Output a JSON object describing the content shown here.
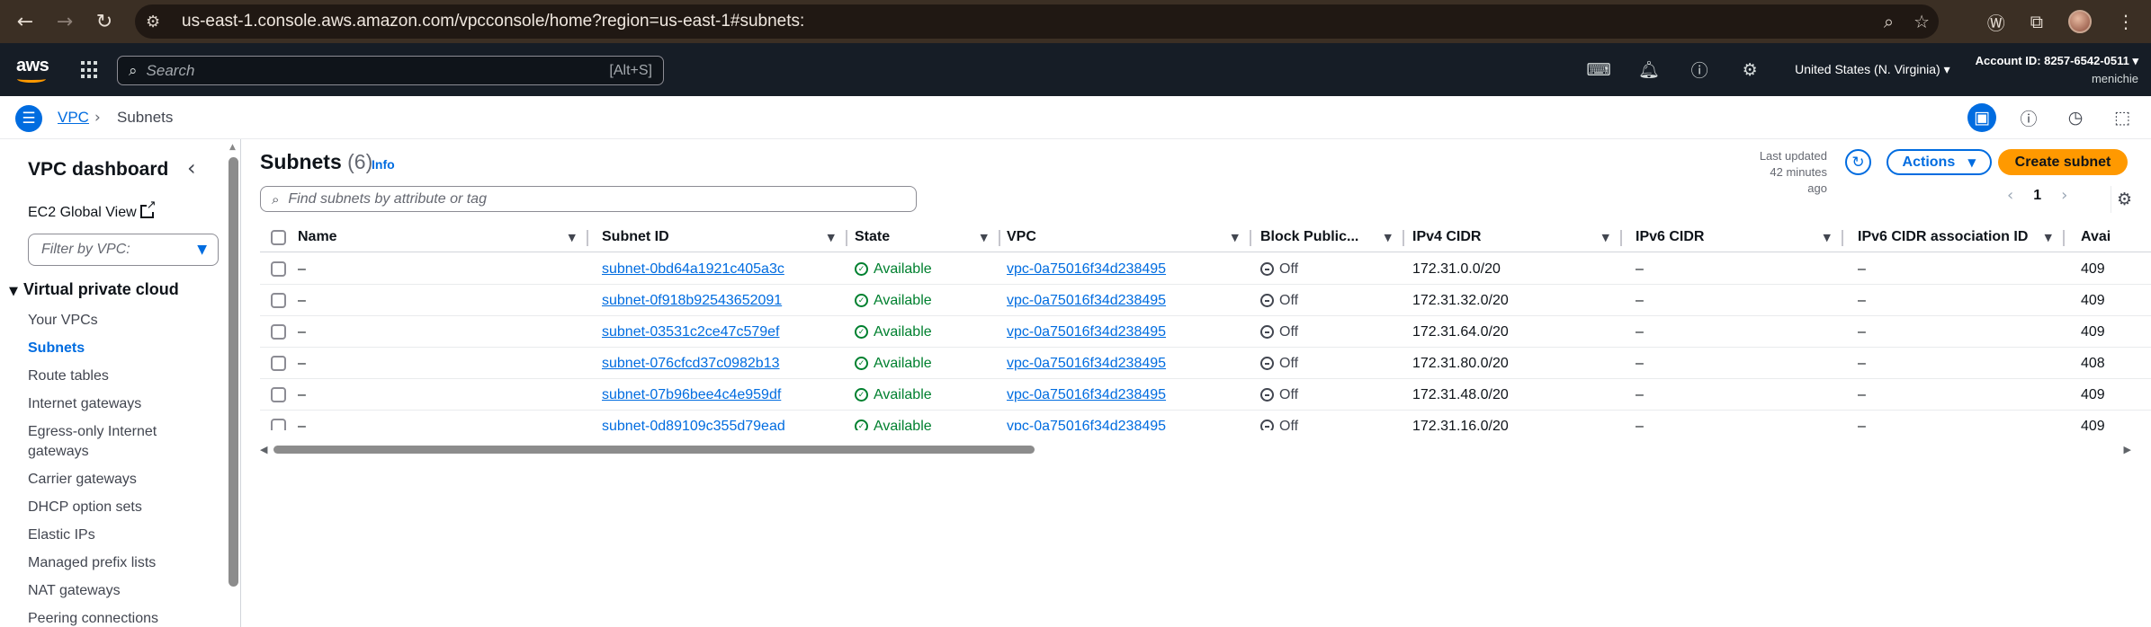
{
  "browser": {
    "url": "us-east-1.console.aws.amazon.com/vpcconsole/home?region=us-east-1#subnets:"
  },
  "aws_nav": {
    "search_placeholder": "Search",
    "search_shortcut": "[Alt+S]",
    "region": "United States (N. Virginia) ▾",
    "account_id": "Account ID: 8257-6542-0511 ▾",
    "user": "menichie"
  },
  "breadcrumb": {
    "parent": "VPC",
    "separator": "›",
    "current": "Subnets"
  },
  "sidebar": {
    "title": "VPC dashboard",
    "ec2_global_view": "EC2 Global View",
    "filter_placeholder": "Filter by VPC:",
    "section": "Virtual private cloud",
    "items": [
      {
        "label": "Your VPCs"
      },
      {
        "label": "Subnets"
      },
      {
        "label": "Route tables"
      },
      {
        "label": "Internet gateways"
      },
      {
        "label": "Egress-only Internet gateways"
      },
      {
        "label": "Carrier gateways"
      },
      {
        "label": "DHCP option sets"
      },
      {
        "label": "Elastic IPs"
      },
      {
        "label": "Managed prefix lists"
      },
      {
        "label": "NAT gateways"
      },
      {
        "label": "Peering connections"
      }
    ]
  },
  "header": {
    "title": "Subnets",
    "count": "(6)",
    "info": "Info",
    "last_updated_label": "Last updated",
    "last_updated_value": "42 minutes ago",
    "actions_label": "Actions",
    "create_label": "Create subnet",
    "find_placeholder": "Find subnets by attribute or tag",
    "page_number": "1"
  },
  "table": {
    "columns": {
      "name": "Name",
      "subnet_id": "Subnet ID",
      "state": "State",
      "vpc": "VPC",
      "block_public": "Block Public...",
      "ipv4": "IPv4 CIDR",
      "ipv6": "IPv6 CIDR",
      "ipv6_assoc": "IPv6 CIDR association ID",
      "avail": "Avai"
    },
    "rows": [
      {
        "name": "–",
        "subnet_id": "subnet-0bd64a1921c405a3c",
        "state": "Available",
        "vpc": "vpc-0a75016f34d238495",
        "block": "Off",
        "ipv4": "172.31.0.0/20",
        "ipv6": "–",
        "ipv6_assoc": "–",
        "avail": "409"
      },
      {
        "name": "–",
        "subnet_id": "subnet-0f918b92543652091",
        "state": "Available",
        "vpc": "vpc-0a75016f34d238495",
        "block": "Off",
        "ipv4": "172.31.32.0/20",
        "ipv6": "–",
        "ipv6_assoc": "–",
        "avail": "409"
      },
      {
        "name": "–",
        "subnet_id": "subnet-03531c2ce47c579ef",
        "state": "Available",
        "vpc": "vpc-0a75016f34d238495",
        "block": "Off",
        "ipv4": "172.31.64.0/20",
        "ipv6": "–",
        "ipv6_assoc": "–",
        "avail": "409"
      },
      {
        "name": "–",
        "subnet_id": "subnet-076cfcd37c0982b13",
        "state": "Available",
        "vpc": "vpc-0a75016f34d238495",
        "block": "Off",
        "ipv4": "172.31.80.0/20",
        "ipv6": "–",
        "ipv6_assoc": "–",
        "avail": "408"
      },
      {
        "name": "–",
        "subnet_id": "subnet-07b96bee4c4e959df",
        "state": "Available",
        "vpc": "vpc-0a75016f34d238495",
        "block": "Off",
        "ipv4": "172.31.48.0/20",
        "ipv6": "–",
        "ipv6_assoc": "–",
        "avail": "409"
      },
      {
        "name": "–",
        "subnet_id": "subnet-0d89109c355d79ead",
        "state": "Available",
        "vpc": "vpc-0a75016f34d238495",
        "block": "Off",
        "ipv4": "172.31.16.0/20",
        "ipv6": "–",
        "ipv6_assoc": "–",
        "avail": "409"
      }
    ]
  },
  "colors": {
    "accent": "#006ce0",
    "primary_button": "#ff9900",
    "success": "#00802f",
    "nav_bg": "#161d26"
  }
}
